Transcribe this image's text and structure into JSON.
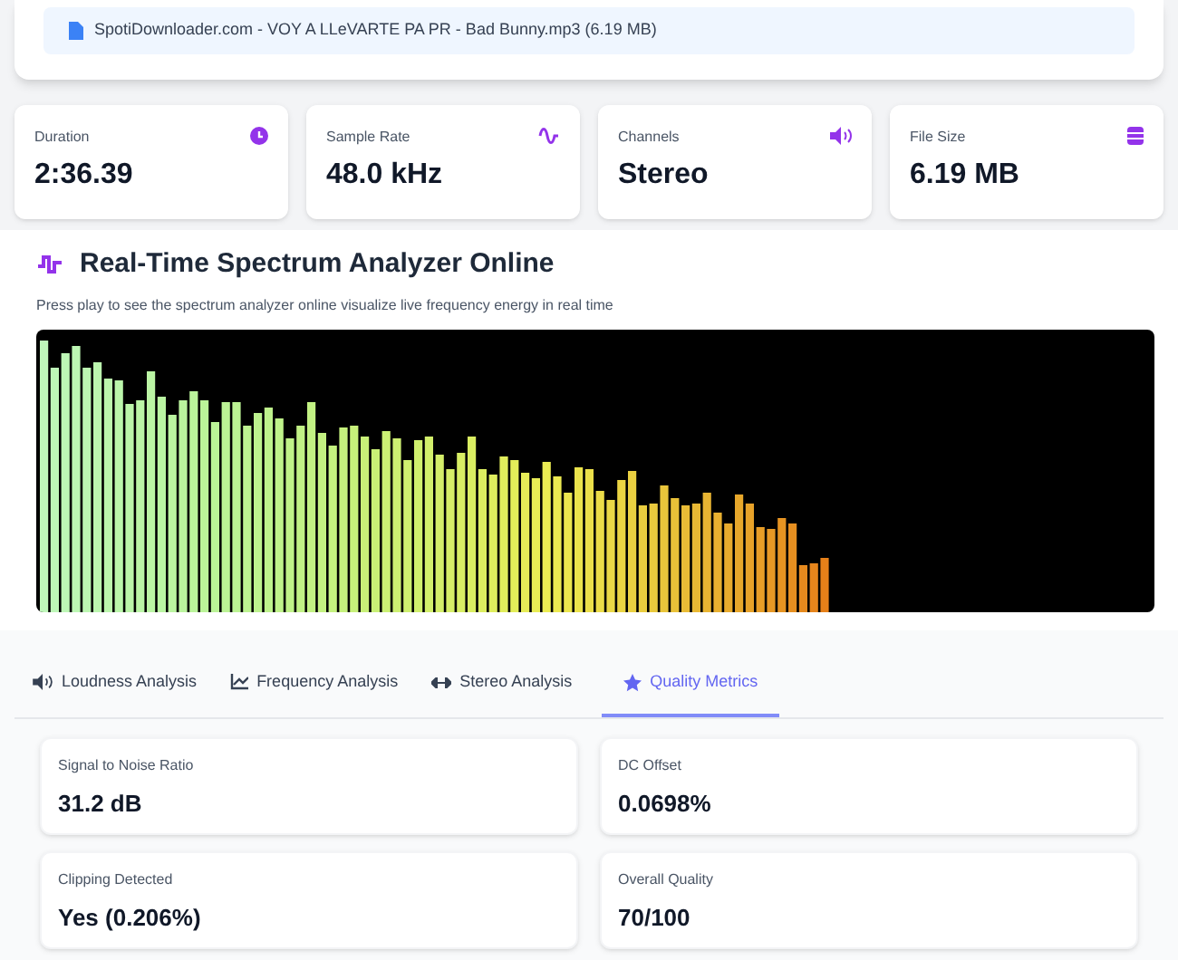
{
  "file": {
    "name": "SpotiDownloader.com - VOY A LLeVARTE PA PR - Bad Bunny.mp3 (6.19 MB)"
  },
  "stats": [
    {
      "label": "Duration",
      "value": "2:36.39",
      "kind": "clock"
    },
    {
      "label": "Sample Rate",
      "value": "48.0 kHz",
      "kind": "wave"
    },
    {
      "label": "Channels",
      "value": "Stereo",
      "kind": "speaker"
    },
    {
      "label": "File Size",
      "value": "6.19 MB",
      "kind": "database"
    }
  ],
  "spectrum": {
    "title": "Real-Time Spectrum Analyzer Online",
    "subtitle": "Press play to see the spectrum analyzer online visualize live frequency energy in real time"
  },
  "tabs": [
    {
      "label": "Loudness Analysis",
      "kind": "speaker",
      "selected": false
    },
    {
      "label": "Frequency Analysis",
      "kind": "chart",
      "selected": false
    },
    {
      "label": "Stereo Analysis",
      "kind": "arrows",
      "selected": false
    },
    {
      "label": "Quality Metrics",
      "kind": "star",
      "selected": true
    }
  ],
  "metrics": [
    {
      "label": "Signal to Noise Ratio",
      "value": "31.2 dB"
    },
    {
      "label": "DC Offset",
      "value": "0.0698%"
    },
    {
      "label": "Clipping Detected",
      "value": "Yes (0.206%)"
    },
    {
      "label": "Overall Quality",
      "value": "70/100"
    }
  ]
}
